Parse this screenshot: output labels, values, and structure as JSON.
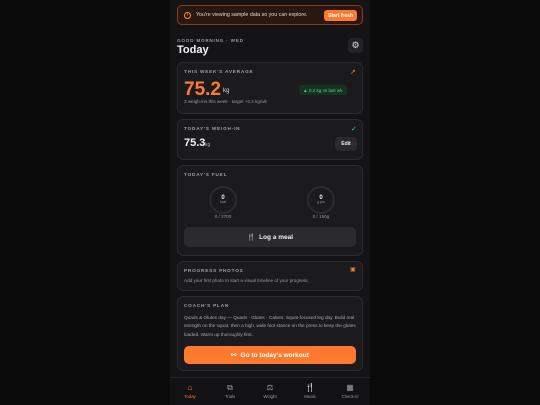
{
  "banner": {
    "text": "You're viewing sample data so you can explore.",
    "button": "Start fresh",
    "icon": "info-icon"
  },
  "header": {
    "greeting": "GOOD MORNING · WED",
    "title": "Today",
    "settings_icon": "gear-icon"
  },
  "weekly_average": {
    "label": "THIS WEEK'S AVERAGE",
    "value": "75.2",
    "unit": "kg",
    "delta": "▲ 0.2 kg vs last wk",
    "subtitle": "3 weigh-ins this week · target +0.2 kg/wk"
  },
  "weigh_in": {
    "label": "TODAY'S WEIGH-IN",
    "value": "75.3",
    "unit": "kg",
    "edit_label": "Edit"
  },
  "fuel": {
    "label": "TODAY'S FUEL",
    "kcal": {
      "value": "0",
      "unit": "kcal",
      "caption": "0 / 2700",
      "progress": 0
    },
    "protein": {
      "value": "0",
      "unit": "g pro",
      "caption": "0 / 150g",
      "progress": 0
    },
    "log_meal_label": "Log a meal"
  },
  "photos": {
    "label": "PROGRESS PHOTOS",
    "text": "Add your first photo to start a visual timeline of your progress."
  },
  "plan": {
    "label": "COACH'S PLAN",
    "text": "Quads & Glutes day — Quads · Glutes · Calves. Squat-focused leg day. Build real strength on the squat, then a high, wide foot stance on the press to keep the glutes loaded. Warm up thoroughly first.",
    "cta": "Go to today's workout"
  },
  "tabs": [
    {
      "label": "Today",
      "icon": "home-icon",
      "active": true
    },
    {
      "label": "Trials",
      "icon": "trials-icon",
      "active": false
    },
    {
      "label": "Weight",
      "icon": "scale-icon",
      "active": false
    },
    {
      "label": "Meals",
      "icon": "fork-knife-icon",
      "active": false
    },
    {
      "label": "Check-in",
      "icon": "calendar-icon",
      "active": false
    }
  ],
  "colors": {
    "accent": "#ff7a2f",
    "positive": "#55d27b",
    "surface": "#1b1b1e",
    "background": "#141416"
  }
}
